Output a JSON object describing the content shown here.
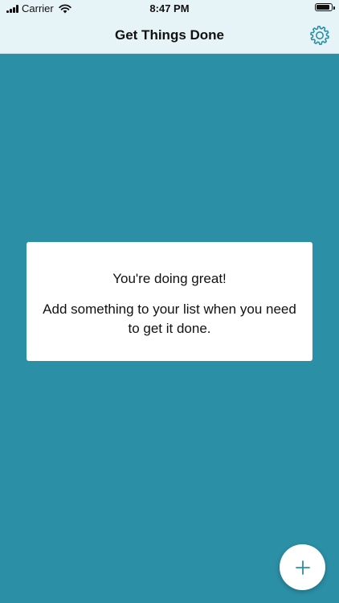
{
  "status_bar": {
    "carrier": "Carrier",
    "time": "8:47 PM",
    "battery_level": 0.9
  },
  "nav_bar": {
    "title": "Get Things Done",
    "settings_icon": "gear-icon"
  },
  "empty_state": {
    "title": "You're doing great!",
    "message": "Add something to your list when you need to get it done."
  },
  "fab": {
    "icon": "plus-icon"
  },
  "colors": {
    "background": "#2b8fa6",
    "nav_background": "#e6f4f7",
    "accent": "#2b8fa6",
    "card": "#ffffff",
    "text": "#111111"
  }
}
